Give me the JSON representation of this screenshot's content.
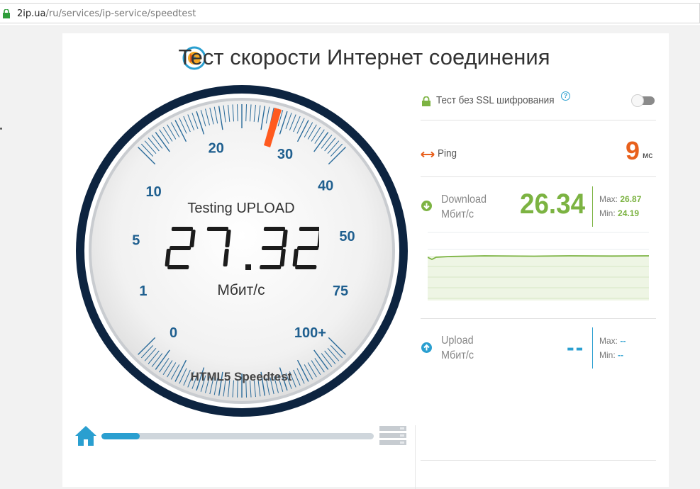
{
  "browser": {
    "url_host": "2ip.ua",
    "url_path": "/ru/services/ip-service/speedtest"
  },
  "header": {
    "title": "Тест скорости Интернет соединения"
  },
  "gauge": {
    "status": "Testing UPLOAD",
    "value": "27.32",
    "unit": "Мбит/с",
    "brand": "HTML5 Speedtest",
    "scale_labels": [
      "0",
      "1",
      "5",
      "10",
      "20",
      "30",
      "40",
      "50",
      "75",
      "100+"
    ],
    "needle_value_label": "30"
  },
  "progress": {
    "fraction": 0.14
  },
  "ssl": {
    "label": "Тест без SSL шифрования",
    "help": "?",
    "enabled": false
  },
  "ping": {
    "label": "Ping",
    "value": "9",
    "unit": "мс"
  },
  "download": {
    "label_line1": "Download",
    "label_line2": "Мбит/с",
    "value": "26.34",
    "max_label": "Max:",
    "max_value": "26.87",
    "min_label": "Min:",
    "min_value": "24.19"
  },
  "upload": {
    "label_line1": "Upload",
    "label_line2": "Мбит/с",
    "value": "--",
    "max_label": "Max:",
    "max_value": "--",
    "min_label": "Min:",
    "min_value": "--"
  },
  "colors": {
    "navy": "#0d2440",
    "accent_orange": "#e8601c",
    "green": "#7cb342",
    "blue": "#2a9fd0",
    "tick_blue": "#2a6b9a"
  },
  "icons": {
    "lock": "lock-icon",
    "logo": "speedometer-logo-icon",
    "ping": "double-arrow-icon",
    "download": "download-arrow-icon",
    "upload": "upload-arrow-icon",
    "home": "home-icon",
    "server": "server-icon"
  }
}
